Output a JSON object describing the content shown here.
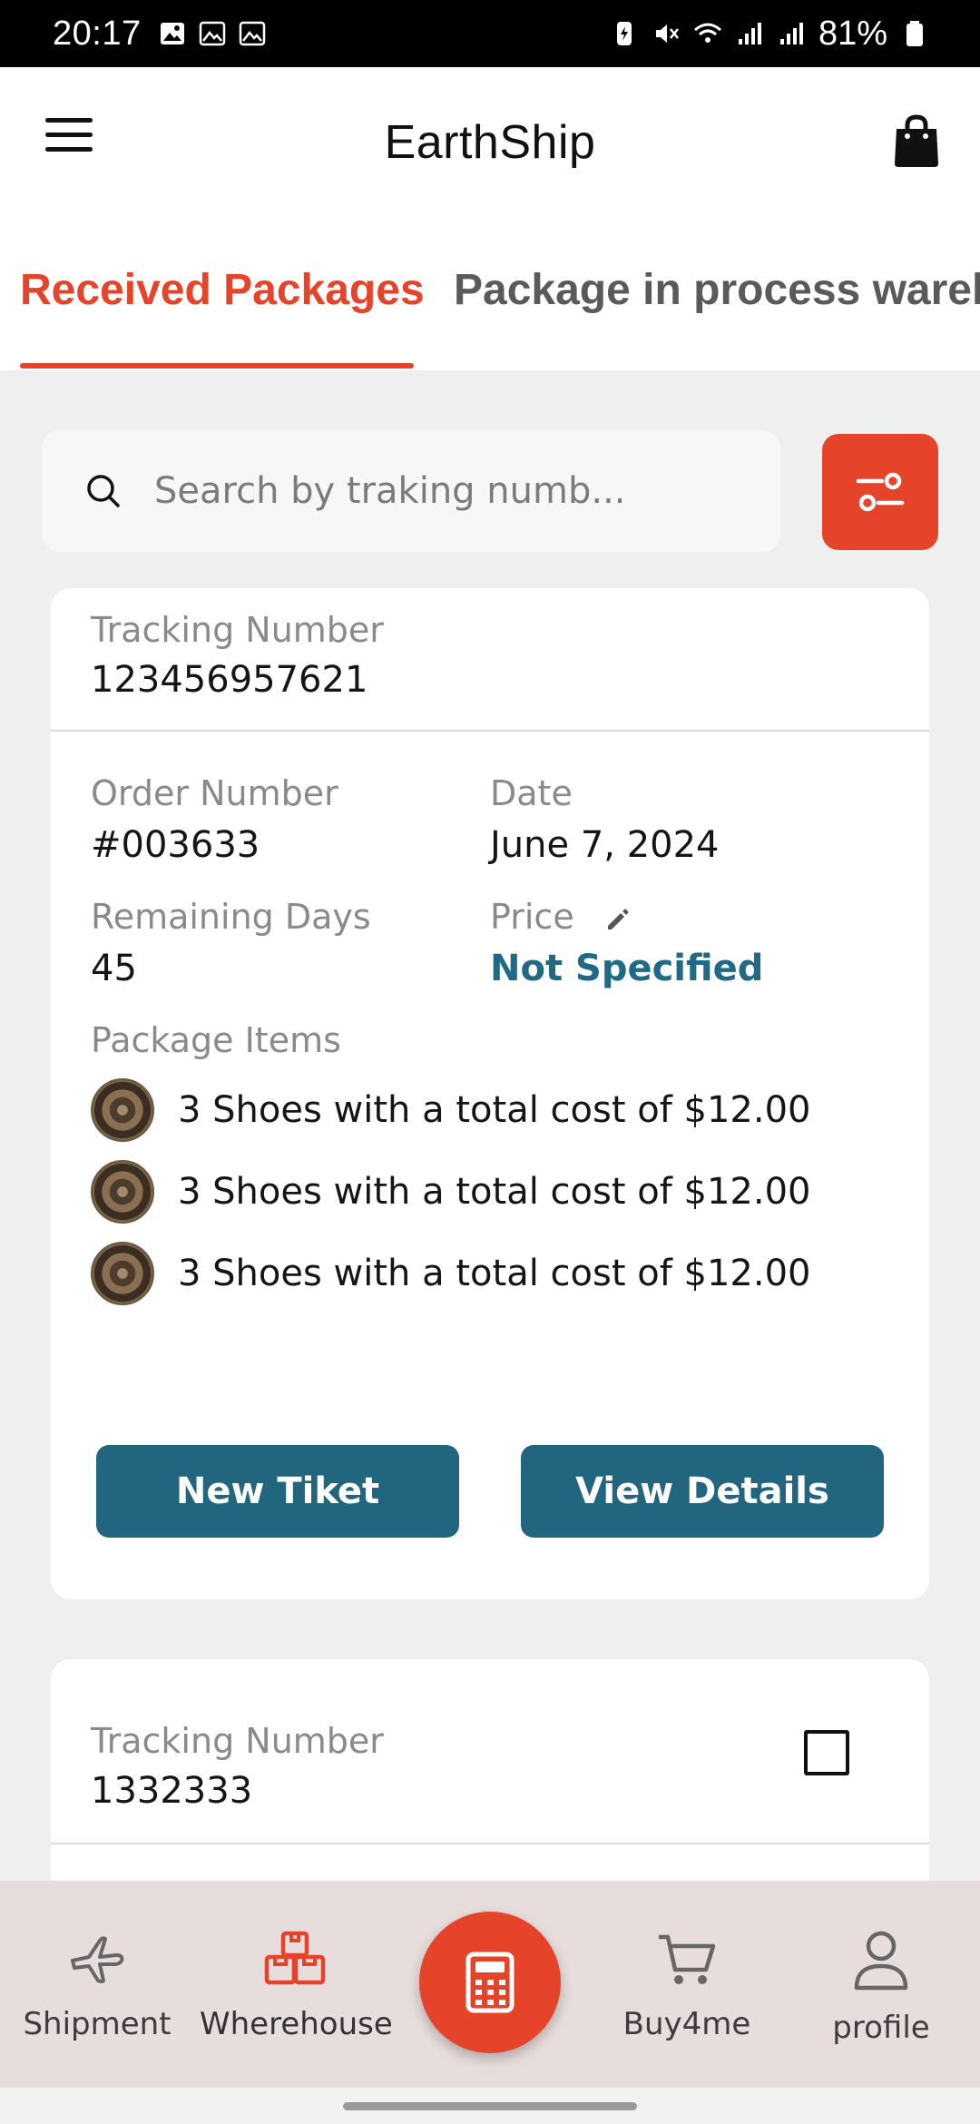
{
  "status_bar": {
    "time": "20:17",
    "battery": "81%"
  },
  "header": {
    "title": "EarthShip",
    "menu_icon": "hamburger-icon",
    "bag_icon": "shopping-bag-icon"
  },
  "tabs": [
    {
      "label": "Received Packages",
      "active": true
    },
    {
      "label": "Package in process wareh",
      "active": false
    }
  ],
  "search": {
    "placeholder": "Search by traking numb..."
  },
  "colors": {
    "accent": "#e5432a",
    "button": "#22657e",
    "link": "#206a86"
  },
  "packages": [
    {
      "tracking_label": "Tracking Number",
      "tracking_number": "123456957621",
      "order_label": "Order Number",
      "order_number": "#003633",
      "date_label": "Date",
      "date": "June 7, 2024",
      "remaining_label": "Remaining Days",
      "remaining_days": "45",
      "price_label": "Price",
      "price": "Not Specified",
      "items_label": "Package Items",
      "items": [
        "3 Shoes with a total cost of $12.00",
        "3 Shoes with a total cost of $12.00",
        "3 Shoes with a total cost of $12.00"
      ],
      "new_ticket_label": "New Tiket",
      "view_details_label": "View Details"
    },
    {
      "tracking_label": "Tracking Number",
      "tracking_number": "1332333"
    }
  ],
  "bottom_nav": {
    "items": [
      {
        "label": "Shipment",
        "icon": "airplane-icon"
      },
      {
        "label": "Wherehouse",
        "icon": "boxes-icon"
      },
      {
        "label": "Buy4me",
        "icon": "cart-icon"
      },
      {
        "label": "profile",
        "icon": "user-icon"
      }
    ],
    "fab_icon": "calculator-icon"
  }
}
